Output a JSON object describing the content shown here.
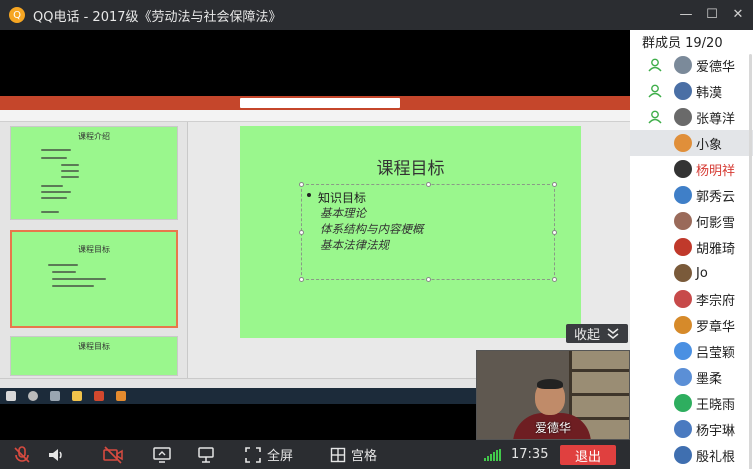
{
  "window": {
    "app_title": "QQ电话 - 2017级《劳动法与社会保障法》",
    "logo_char": "Q",
    "minimize": "—",
    "maximize": "☐",
    "close": "✕"
  },
  "slide": {
    "title": "课程目标",
    "bullet": "知识目标",
    "items": [
      "基本理论",
      "体系结构与内容梗概",
      "基本法律法规"
    ]
  },
  "thumbnails": [
    {
      "title": "课程介绍"
    },
    {
      "title": "课程目标"
    },
    {
      "title": "课程目标"
    }
  ],
  "collapse": {
    "label": "收起"
  },
  "camera": {
    "name": "爱德华"
  },
  "toolbar": {
    "fullscreen_label": "全屏",
    "grid_label": "宫格",
    "time": "17:35",
    "exit_label": "退出"
  },
  "panel": {
    "header": "群成员 19/20",
    "members": [
      {
        "name": "爱德华",
        "role": "admin",
        "color": "#7b8a9a"
      },
      {
        "name": "韩漠",
        "role": "admin",
        "color": "#4a6fa5"
      },
      {
        "name": "张尊洋",
        "role": "admin",
        "color": "#6a6a6a"
      },
      {
        "name": "小象",
        "role": "none",
        "color": "#e08f3a"
      },
      {
        "name": "杨明祥",
        "role": "none",
        "color": "#333333",
        "highlight": true
      },
      {
        "name": "郭秀云",
        "role": "none",
        "color": "#3f7fc8"
      },
      {
        "name": "何影雪",
        "role": "none",
        "color": "#9a6a5a"
      },
      {
        "name": "胡雅琦",
        "role": "none",
        "color": "#c0392b"
      },
      {
        "name": "Jo",
        "role": "none",
        "color": "#7a5a3a"
      },
      {
        "name": "李宗府",
        "role": "none",
        "color": "#c74a4a"
      },
      {
        "name": "罗章华",
        "role": "none",
        "color": "#d68a2a"
      },
      {
        "name": "吕莹颖",
        "role": "none",
        "color": "#4a90e2"
      },
      {
        "name": "墨柔",
        "role": "none",
        "color": "#5b8fd6"
      },
      {
        "name": "王晓雨",
        "role": "none",
        "color": "#2eae5f"
      },
      {
        "name": "杨宇琳",
        "role": "none",
        "color": "#4a7ac0"
      },
      {
        "name": "殷礼根",
        "role": "none",
        "color": "#3f6fb0"
      }
    ]
  },
  "colors": {
    "slide_bg": "#9af78d",
    "exit_red": "#e0403f",
    "signal_green": "#42c84b",
    "ppt_red": "#c5462b"
  }
}
